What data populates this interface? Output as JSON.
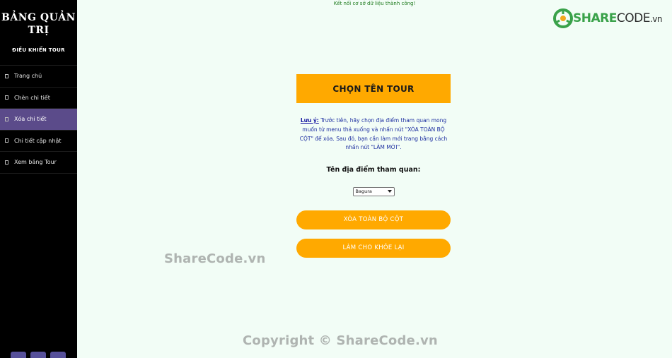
{
  "sidebar": {
    "title_line1": "BẢNG QUẢN",
    "title_line2": "TRỊ",
    "subtitle": "ĐIỀU KHIỂN TOUR",
    "items": [
      {
        "label": "Trang chủ",
        "active": false
      },
      {
        "label": "Chèn chi tiết",
        "active": false
      },
      {
        "label": "Xóa chi tiết",
        "active": true
      },
      {
        "label": "Chi tiết cập nhật",
        "active": false
      },
      {
        "label": "Xem bảng Tour",
        "active": false
      }
    ]
  },
  "status": "Kết nối cơ sở dữ liệu thành công!",
  "logo": {
    "part1": "SHARE",
    "part2": "CODE",
    "part3": ".vn"
  },
  "main": {
    "heading": "CHỌN TÊN TOUR",
    "note_label": "Lưu ý:",
    "note_text": " Trước tiên, hãy chọn địa điểm tham quan mong muốn từ menu thả xuống và nhấn nút \"XÓA TOÀN BỘ CỘT\" để xóa. Sau đó, bạn cần làm mới trang bằng cách nhấn nút \"LÀM MỚI\".",
    "field_label": "Tên địa điểm tham quan:",
    "selected_place": "Bagura",
    "delete_button": "XÓA TOÀN BỘ CỘT",
    "refresh_button": "LÀM CHO KHỎE LẠI"
  },
  "watermark": {
    "center": "ShareCode.vn",
    "bottom": "Copyright © ShareCode.vn"
  },
  "colors": {
    "accent": "#ffa900",
    "active": "#5b4b8a",
    "background": "#f2fdf6"
  }
}
